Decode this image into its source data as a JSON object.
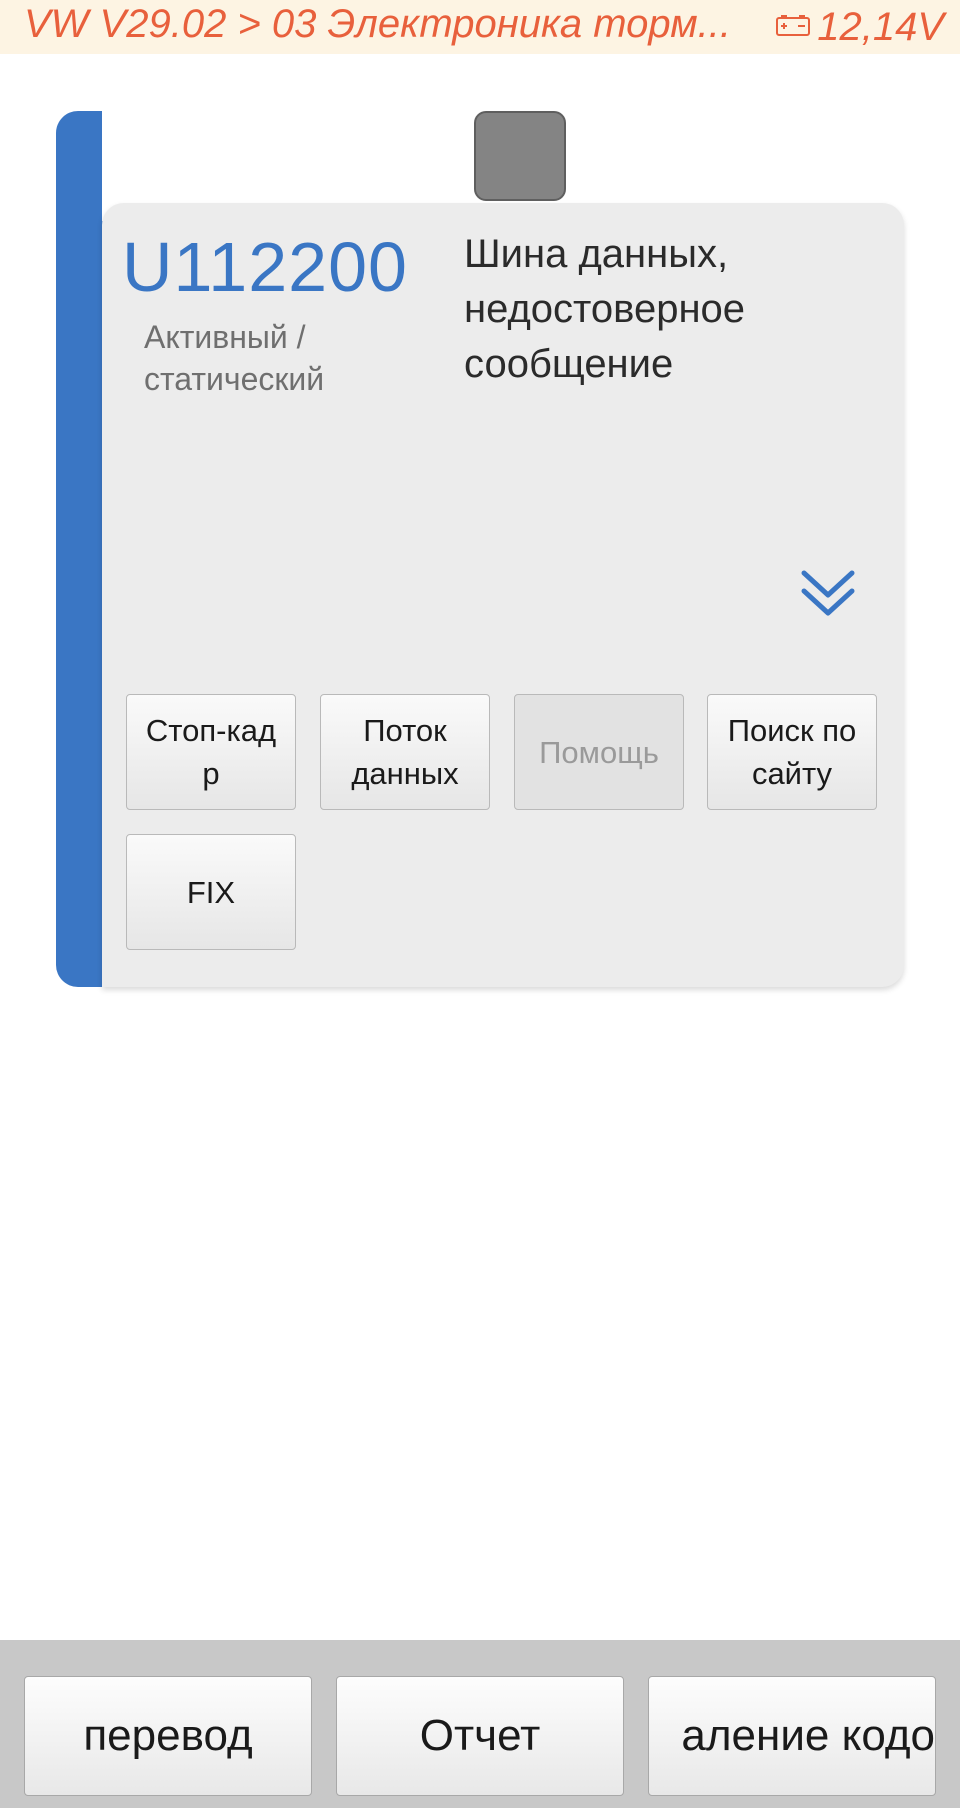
{
  "header": {
    "title": "VW V29.02 > 03 Электроника торм...",
    "voltage": "12,14V",
    "battery_icon": "battery-icon",
    "text_color": "#e8603c",
    "background": "#fdf4e3"
  },
  "fault": {
    "code": "U112200",
    "status_line1": "Активный /",
    "status_line2": "статический",
    "description": "Шина данных, недостоверное сообщение",
    "accent_color": "#3a76c4",
    "status_indicator_color": "#848484",
    "expand_icon": "double-chevron-down-icon"
  },
  "actions": {
    "freeze_frame_line1": "Стоп-кад",
    "freeze_frame_line2": "р",
    "data_stream_line1": "Поток",
    "data_stream_line2": "данных",
    "help": "Помощь",
    "site_search_line1": "Поиск по",
    "site_search_line2": "сайту",
    "fix": "FIX"
  },
  "bottom_bar": {
    "translate": "перевод",
    "report": "Отчет",
    "clear_codes_visible": "аление кодо"
  }
}
